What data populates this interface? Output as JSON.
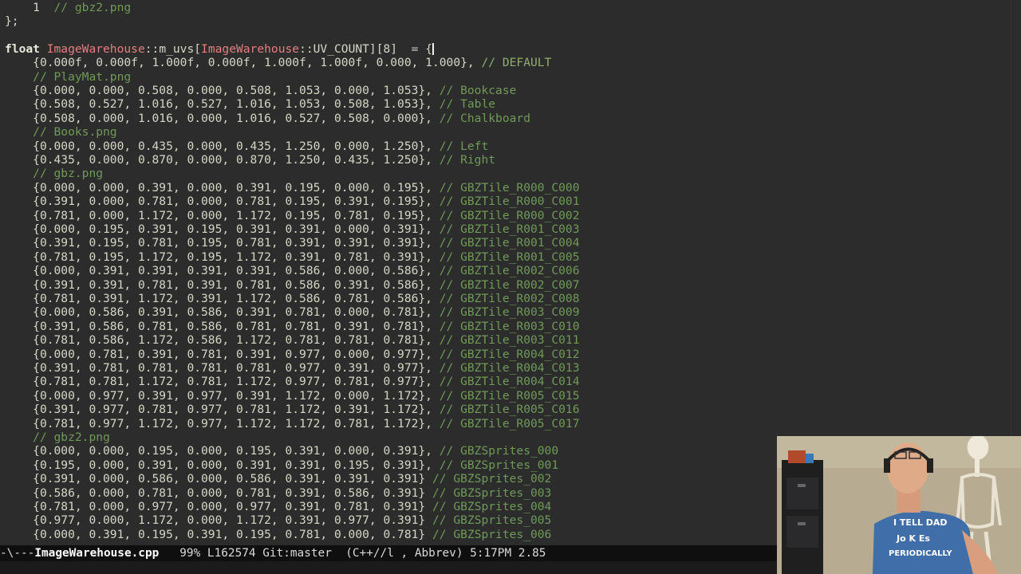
{
  "editor": {
    "lines": [
      {
        "indent": "    ",
        "code": "1  ",
        "comment": "// gbz2.png",
        "trail": ""
      },
      {
        "code": "};",
        "comment": "",
        "trail": ""
      },
      {
        "code": "",
        "comment": "",
        "trail": ""
      },
      {
        "header": true
      },
      {
        "indent": "    ",
        "code": "{0.000f, 0.000f, 1.000f, 0.000f, 1.000f, 1.000f, 0.000, 1.000},",
        "comment": " // DEFAULT",
        "cmt_plain": true
      },
      {
        "indent": "    ",
        "code": "",
        "comment": "// PlayMat.png"
      },
      {
        "indent": "    ",
        "code": "{0.000, 0.000, 0.508, 0.000, 0.508, 1.053, 0.000, 1.053},",
        "comment": " // Bookcase"
      },
      {
        "indent": "    ",
        "code": "{0.508, 0.527, 1.016, 0.527, 1.016, 1.053, 0.508, 1.053},",
        "comment": " // Table"
      },
      {
        "indent": "    ",
        "code": "{0.508, 0.000, 1.016, 0.000, 1.016, 0.527, 0.508, 0.000},",
        "comment": " // Chalkboard"
      },
      {
        "indent": "    ",
        "code": "",
        "comment": "// Books.png"
      },
      {
        "indent": "    ",
        "code": "{0.000, 0.000, 0.435, 0.000, 0.435, 1.250, 0.000, 1.250},",
        "comment": " // Left"
      },
      {
        "indent": "    ",
        "code": "{0.435, 0.000, 0.870, 0.000, 0.870, 1.250, 0.435, 1.250},",
        "comment": " // Right"
      },
      {
        "indent": "    ",
        "code": "",
        "comment": "// gbz.png"
      },
      {
        "indent": "    ",
        "code": "{0.000, 0.000, 0.391, 0.000, 0.391, 0.195, 0.000, 0.195},",
        "comment": " // GBZTile_R000_C000"
      },
      {
        "indent": "    ",
        "code": "{0.391, 0.000, 0.781, 0.000, 0.781, 0.195, 0.391, 0.195},",
        "comment": " // GBZTile_R000_C001"
      },
      {
        "indent": "    ",
        "code": "{0.781, 0.000, 1.172, 0.000, 1.172, 0.195, 0.781, 0.195},",
        "comment": " // GBZTile_R000_C002"
      },
      {
        "indent": "    ",
        "code": "{0.000, 0.195, 0.391, 0.195, 0.391, 0.391, 0.000, 0.391},",
        "comment": " // GBZTile_R001_C003"
      },
      {
        "indent": "    ",
        "code": "{0.391, 0.195, 0.781, 0.195, 0.781, 0.391, 0.391, 0.391},",
        "comment": " // GBZTile_R001_C004"
      },
      {
        "indent": "    ",
        "code": "{0.781, 0.195, 1.172, 0.195, 1.172, 0.391, 0.781, 0.391},",
        "comment": " // GBZTile_R001_C005"
      },
      {
        "indent": "    ",
        "code": "{0.000, 0.391, 0.391, 0.391, 0.391, 0.586, 0.000, 0.586},",
        "comment": " // GBZTile_R002_C006"
      },
      {
        "indent": "    ",
        "code": "{0.391, 0.391, 0.781, 0.391, 0.781, 0.586, 0.391, 0.586},",
        "comment": " // GBZTile_R002_C007"
      },
      {
        "indent": "    ",
        "code": "{0.781, 0.391, 1.172, 0.391, 1.172, 0.586, 0.781, 0.586},",
        "comment": " // GBZTile_R002_C008"
      },
      {
        "indent": "    ",
        "code": "{0.000, 0.586, 0.391, 0.586, 0.391, 0.781, 0.000, 0.781},",
        "comment": " // GBZTile_R003_C009"
      },
      {
        "indent": "    ",
        "code": "{0.391, 0.586, 0.781, 0.586, 0.781, 0.781, 0.391, 0.781},",
        "comment": " // GBZTile_R003_C010"
      },
      {
        "indent": "    ",
        "code": "{0.781, 0.586, 1.172, 0.586, 1.172, 0.781, 0.781, 0.781},",
        "comment": " // GBZTile_R003_C011"
      },
      {
        "indent": "    ",
        "code": "{0.000, 0.781, 0.391, 0.781, 0.391, 0.977, 0.000, 0.977},",
        "comment": " // GBZTile_R004_C012"
      },
      {
        "indent": "    ",
        "code": "{0.391, 0.781, 0.781, 0.781, 0.781, 0.977, 0.391, 0.977},",
        "comment": " // GBZTile_R004_C013"
      },
      {
        "indent": "    ",
        "code": "{0.781, 0.781, 1.172, 0.781, 1.172, 0.977, 0.781, 0.977},",
        "comment": " // GBZTile_R004_C014"
      },
      {
        "indent": "    ",
        "code": "{0.000, 0.977, 0.391, 0.977, 0.391, 1.172, 0.000, 1.172},",
        "comment": " // GBZTile_R005_C015"
      },
      {
        "indent": "    ",
        "code": "{0.391, 0.977, 0.781, 0.977, 0.781, 1.172, 0.391, 1.172},",
        "comment": " // GBZTile_R005_C016"
      },
      {
        "indent": "    ",
        "code": "{0.781, 0.977, 1.172, 0.977, 1.172, 1.172, 0.781, 1.172},",
        "comment": " // GBZTile_R005_C017"
      },
      {
        "indent": "    ",
        "code": "",
        "comment": "// gbz2.png"
      },
      {
        "indent": "    ",
        "code": "{0.000, 0.000, 0.195, 0.000, 0.195, 0.391, 0.000, 0.391},",
        "comment": " // GBZSprites_000"
      },
      {
        "indent": "    ",
        "code": "{0.195, 0.000, 0.391, 0.000, 0.391, 0.391, 0.195, 0.391},",
        "comment": " // GBZSprites_001"
      },
      {
        "indent": "    ",
        "code": "{0.391, 0.000, 0.586, 0.000, 0.586, 0.391, 0.391, 0.391}",
        "comment": " // GBZSprites_002"
      },
      {
        "indent": "    ",
        "code": "{0.586, 0.000, 0.781, 0.000, 0.781, 0.391, 0.586, 0.391}",
        "comment": " // GBZSprites_003"
      },
      {
        "indent": "    ",
        "code": "{0.781, 0.000, 0.977, 0.000, 0.977, 0.391, 0.781, 0.391}",
        "comment": " // GBZSprites_004"
      },
      {
        "indent": "    ",
        "code": "{0.977, 0.000, 1.172, 0.000, 1.172, 0.391, 0.977, 0.391}",
        "comment": " // GBZSprites_005"
      },
      {
        "indent": "    ",
        "code": "{0.000, 0.391, 0.195, 0.391, 0.195, 0.781, 0.000, 0.781}",
        "comment": " // GBZSprites_006"
      }
    ],
    "header": {
      "kw": "float",
      "type1": "ImageWarehouse",
      "sep1": "::m_uvs[",
      "type2": "ImageWarehouse",
      "rest": "::UV_COUNT][8]  = {"
    }
  },
  "modeline": {
    "prefix": "-\\---",
    "buffer": "ImageWarehouse.cpp",
    "rest": "   99% L162574 Git:master  (C++//l , Abbrev) 5:17PM 2.85"
  },
  "colors": {
    "background": "#2c2c2c",
    "text": "#d6d6c8",
    "keyword": "#e8e8dc",
    "type": "#e57f7f",
    "comment": "#6f9a57",
    "modeline_bg": "#0f0f0f"
  },
  "webcam": {
    "shirt_text_1": "I TELL DAD",
    "shirt_text_2": "Jo K Es",
    "shirt_text_3": "PERIODICALLY"
  }
}
